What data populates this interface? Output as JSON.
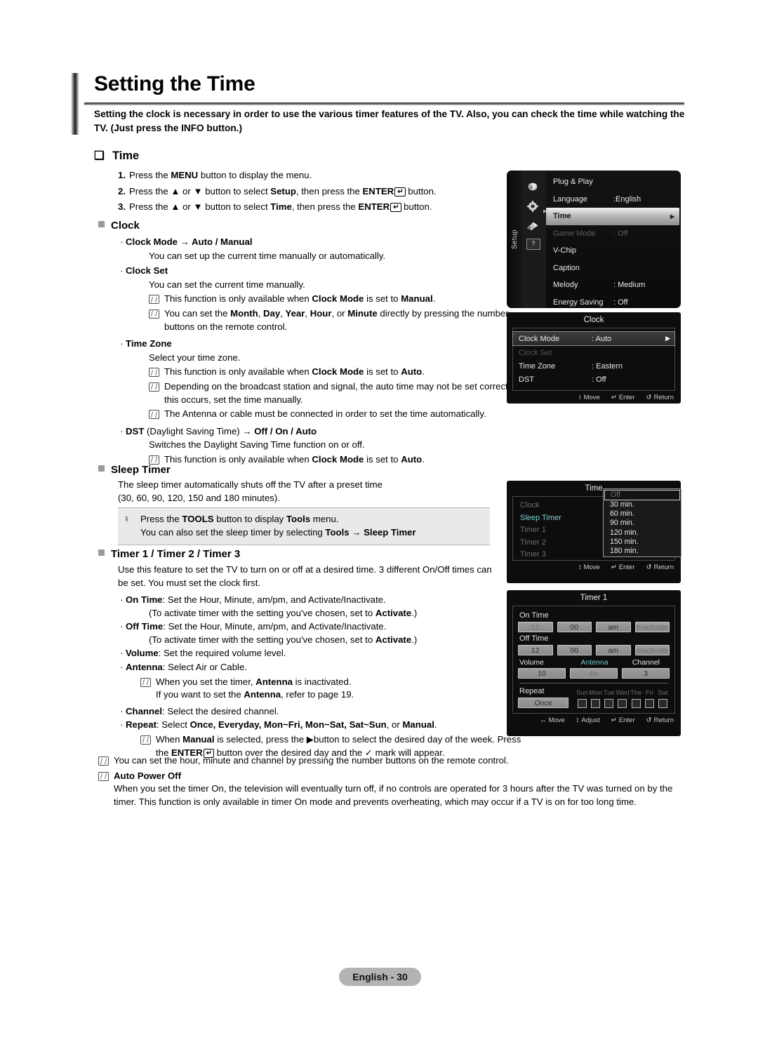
{
  "header": {
    "title": "Setting the Time",
    "intro": "Setting the clock is necessary in order to use the various timer features of the TV. Also, you can check the time while watching the TV. (Just press the INFO button.)"
  },
  "sections": {
    "time_heading": "Time",
    "steps": [
      {
        "num": "1.",
        "text_before": "Press the ",
        "bold1": "MENU",
        "text_mid": " button to display the menu.",
        "bold2": "",
        "text_after": ""
      },
      {
        "num": "2.",
        "text_before": "Press the ▲ or ▼ button to select ",
        "bold1": "Setup",
        "text_mid": ", then press the ",
        "bold2": "ENTER",
        "text_after": " button."
      },
      {
        "num": "3.",
        "text_before": "Press the ▲ or ▼ button to select ",
        "bold1": "Time",
        "text_mid": ", then press the ",
        "bold2": "ENTER",
        "text_after": " button."
      }
    ],
    "clock_heading": "Clock",
    "clock_mode_title": "Clock Mode → Auto / Manual",
    "clock_mode_desc": "You can set up the current time manually or automatically.",
    "clock_set_title": "Clock Set",
    "clock_set_desc": "You can set the current time manually.",
    "clock_set_note1_a": "This function is only available when ",
    "clock_set_note1_b": "Clock Mode",
    "clock_set_note1_c": " is set to ",
    "clock_set_note1_d": "Manual",
    "clock_set_note1_e": ".",
    "clock_set_note2": "You can set the Month, Day, Year, Hour, or Minute directly by pressing the number buttons on the remote control.",
    "time_zone_title": "Time Zone",
    "time_zone_desc": "Select your time zone.",
    "time_zone_note1": "This function is only available when Clock Mode is set to Auto.",
    "time_zone_note2": "Depending on the broadcast station and signal, the auto time may not be set correctly. If this occurs, set the time manually.",
    "time_zone_note3": "The Antenna or cable must be connected in order to set the time automatically.",
    "dst_title_a": "DST",
    "dst_title_b": " (Daylight Saving Time) → ",
    "dst_title_c": "Off / On / Auto",
    "dst_desc": "Switches the Daylight Saving Time function on or off.",
    "dst_note": "This function is only available when Clock Mode is set to Auto.",
    "sleep_heading": "Sleep Timer",
    "sleep_desc1": "The sleep timer automatically shuts off the TV after a preset time",
    "sleep_desc2": "(30, 60, 90, 120, 150 and 180 minutes).",
    "tools_line1_a": "Press the ",
    "tools_line1_b": "TOOLS",
    "tools_line1_c": " button to display ",
    "tools_line1_d": "Tools",
    "tools_line1_e": " menu.",
    "tools_line2_a": "You can also set the sleep timer by selecting ",
    "tools_line2_b": "Tools",
    "tools_line2_c": " → ",
    "tools_line2_d": "Sleep Timer",
    "timer_heading": "Timer 1 / Timer 2 / Timer 3",
    "timer_desc": "Use this feature to set the TV to turn on or off at a desired time. 3 different On/Off times can be set. You must set the clock first.",
    "ontime_label": "On Time",
    "ontime_desc": ": Set the Hour, Minute, am/pm, and Activate/Inactivate.",
    "ontime_sub_a": "(To activate timer with the setting you've chosen, set to ",
    "ontime_sub_b": "Activate",
    "ontime_sub_c": ".)",
    "offtime_label": "Off Time",
    "offtime_desc": ": Set the Hour, Minute, am/pm, and Activate/Inactivate.",
    "volume_label": "Volume",
    "volume_desc": ": Set the required volume level.",
    "antenna_label": "Antenna",
    "antenna_desc": ": Select Air or Cable.",
    "antenna_note1_a": "When you set the timer, ",
    "antenna_note1_b": "Antenna",
    "antenna_note1_c": " is inactivated.",
    "antenna_note2_a": "If you want to set the ",
    "antenna_note2_b": "Antenna",
    "antenna_note2_c": ", refer to page 19.",
    "channel_label": "Channel",
    "channel_desc": ": Select the desired channel.",
    "repeat_label": "Repeat",
    "repeat_desc_a": ": Select ",
    "repeat_opts": "Once, Everyday, Mon~Fri, Mon~Sat, Sat~Sun",
    "repeat_desc_b": ", or ",
    "repeat_opts2": "Manual",
    "repeat_desc_c": ".",
    "repeat_note_a": "When ",
    "repeat_note_b": "Manual",
    "repeat_note_c": " is selected, press the ▶button to select the desired day of the week. Press the ",
    "repeat_note_d": "ENTER",
    "repeat_note_e": " button over the desired day and the ✓ mark will appear.",
    "final_note": "You can set the hour, minute and channel by pressing the number buttons on the remote control.",
    "auto_power_title": "Auto Power Off",
    "auto_power_desc": "When you set the timer On, the television will eventually turn off, if no controls are operated for 3 hours after the TV was turned on by the timer. This function is only available in timer On mode and prevents overheating, which may occur if a TV is on for too long time."
  },
  "setup_menu": {
    "rail_label": "Setup",
    "items": [
      {
        "label": "Plug & Play",
        "value": "",
        "state": "normal"
      },
      {
        "label": "Language",
        "value": ":English",
        "state": "normal"
      },
      {
        "label": "Time",
        "value": "",
        "state": "selected"
      },
      {
        "label": "Game Mode",
        "value": ": Off",
        "state": "dim"
      },
      {
        "label": "V-Chip",
        "value": "",
        "state": "normal"
      },
      {
        "label": "Caption",
        "value": "",
        "state": "normal"
      },
      {
        "label": "Melody",
        "value": ": Medium",
        "state": "normal"
      },
      {
        "label": "Energy Saving",
        "value": ": Off",
        "state": "normal"
      }
    ]
  },
  "clock_menu": {
    "title": "Clock",
    "rows": [
      {
        "label": "Clock Mode",
        "value": ": Auto",
        "state": "selected"
      },
      {
        "label": "Clock Set",
        "value": "",
        "state": "dim"
      },
      {
        "label": "Time Zone",
        "value": ": Eastern",
        "state": "normal"
      },
      {
        "label": "DST",
        "value": ": Off",
        "state": "normal"
      }
    ],
    "footer": {
      "move": "Move",
      "enter": "Enter",
      "return": "Return"
    }
  },
  "sleep_menu": {
    "title": "Time",
    "items": [
      {
        "label": "Clock",
        "active": false
      },
      {
        "label": "Sleep Timer",
        "active": true
      },
      {
        "label": "Timer 1",
        "active": false
      },
      {
        "label": "Timer 2",
        "active": false
      },
      {
        "label": "Timer 3",
        "active": false
      }
    ],
    "options": [
      "Off",
      "30 min.",
      "60 min.",
      "90 min.",
      "120 min.",
      "150 min.",
      "180 min."
    ],
    "footer": {
      "move": "Move",
      "enter": "Enter",
      "return": "Return"
    }
  },
  "timer_menu": {
    "title": "Timer 1",
    "on_time_label": "On Time",
    "on_time": [
      "12",
      "00",
      "am",
      "Inactivate"
    ],
    "off_time_label": "Off Time",
    "off_time": [
      "12",
      "00",
      "am",
      "Inactivate"
    ],
    "triad_labels": {
      "volume": "Volume",
      "antenna": "Antenna",
      "channel": "Channel"
    },
    "triad_values": {
      "volume": "10",
      "antenna": "Air",
      "channel": "3"
    },
    "repeat_label": "Repeat",
    "repeat_value": "Once",
    "days": [
      "Sun",
      "Mon",
      "Tue",
      "Wed",
      "The",
      "Fri",
      "Sat"
    ],
    "footer": {
      "move": "Move",
      "adjust": "Adjust",
      "enter": "Enter",
      "return": "Return"
    }
  },
  "footer": {
    "page": "English - 30"
  }
}
